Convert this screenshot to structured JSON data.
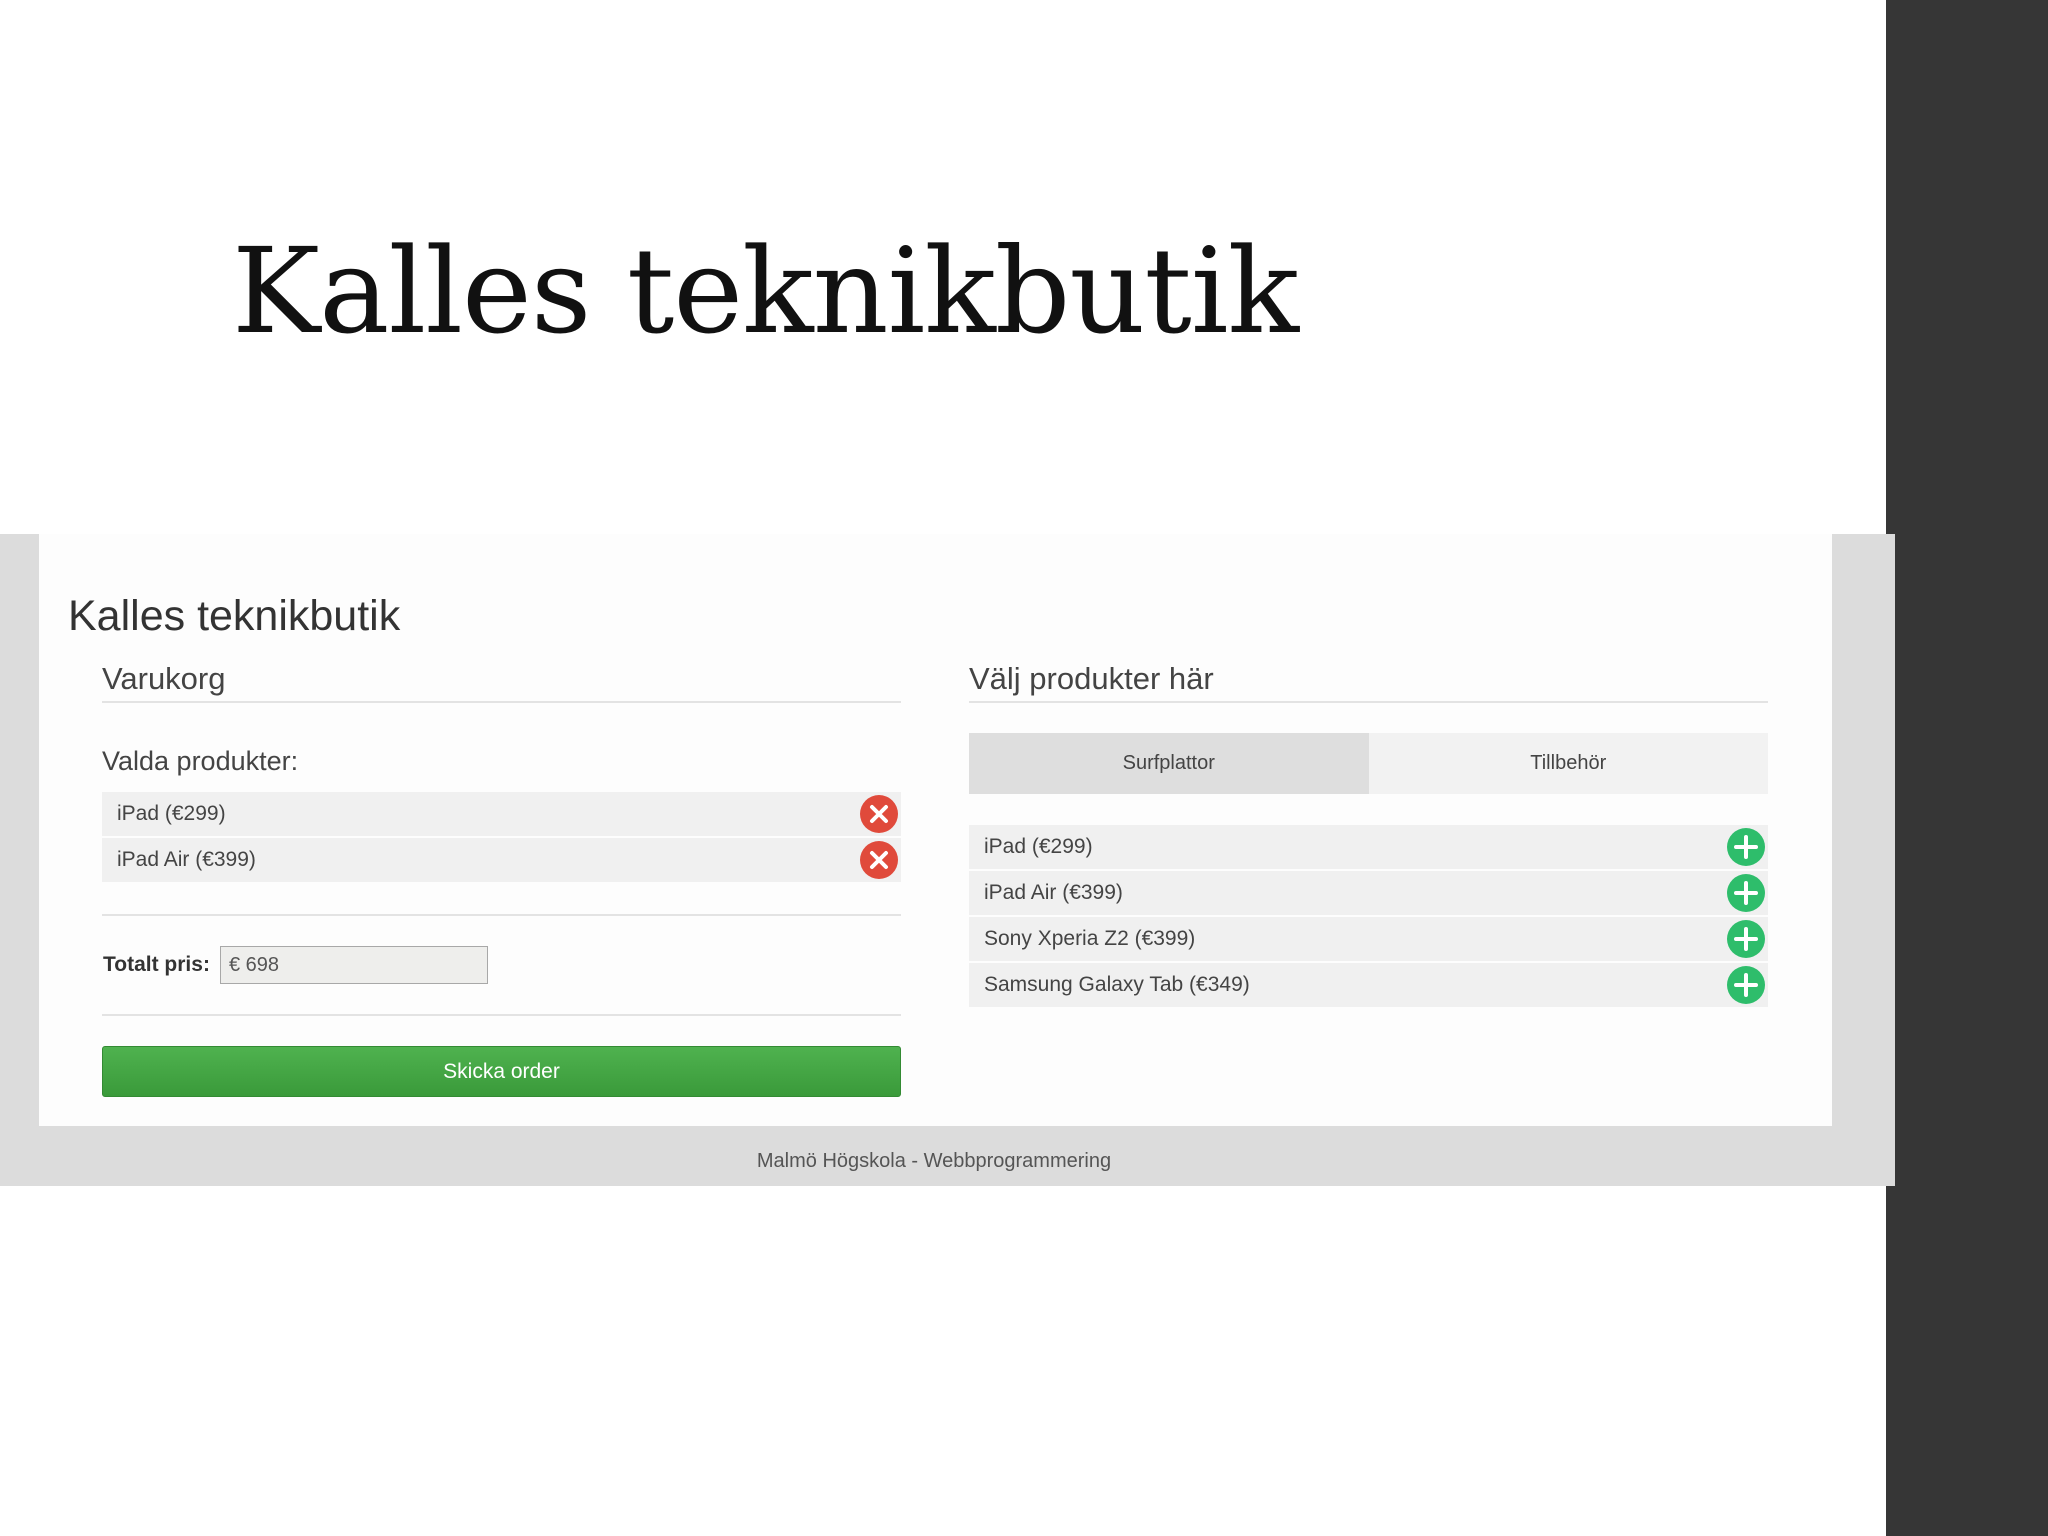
{
  "slide": {
    "title": "Kalles teknikbutik"
  },
  "app": {
    "title": "Kalles teknikbutik",
    "cart": {
      "heading": "Varukorg",
      "selected_label": "Valda produkter:",
      "items": [
        {
          "label": "iPad (€299)"
        },
        {
          "label": "iPad Air (€399)"
        }
      ],
      "total_label": "Totalt pris:",
      "total_value": "€ 698",
      "submit_label": "Skicka order"
    },
    "products": {
      "heading": "Välj produkter här",
      "tabs": [
        {
          "label": "Surfplattor",
          "active": true
        },
        {
          "label": "Tillbehör",
          "active": false
        }
      ],
      "items": [
        {
          "label": "iPad (€299)"
        },
        {
          "label": "iPad Air (€399)"
        },
        {
          "label": "Sony Xperia Z2 (€399)"
        },
        {
          "label": "Samsung Galaxy Tab (€349)"
        }
      ]
    },
    "footer": "Malmö Högskola - Webbprogrammering"
  },
  "icons": {
    "remove": "remove-circle-icon",
    "add": "add-circle-icon"
  },
  "colors": {
    "remove": "#e04a3b",
    "add": "#2ebd6b",
    "submit": "#44a844",
    "dark_sidebar": "#363636"
  }
}
